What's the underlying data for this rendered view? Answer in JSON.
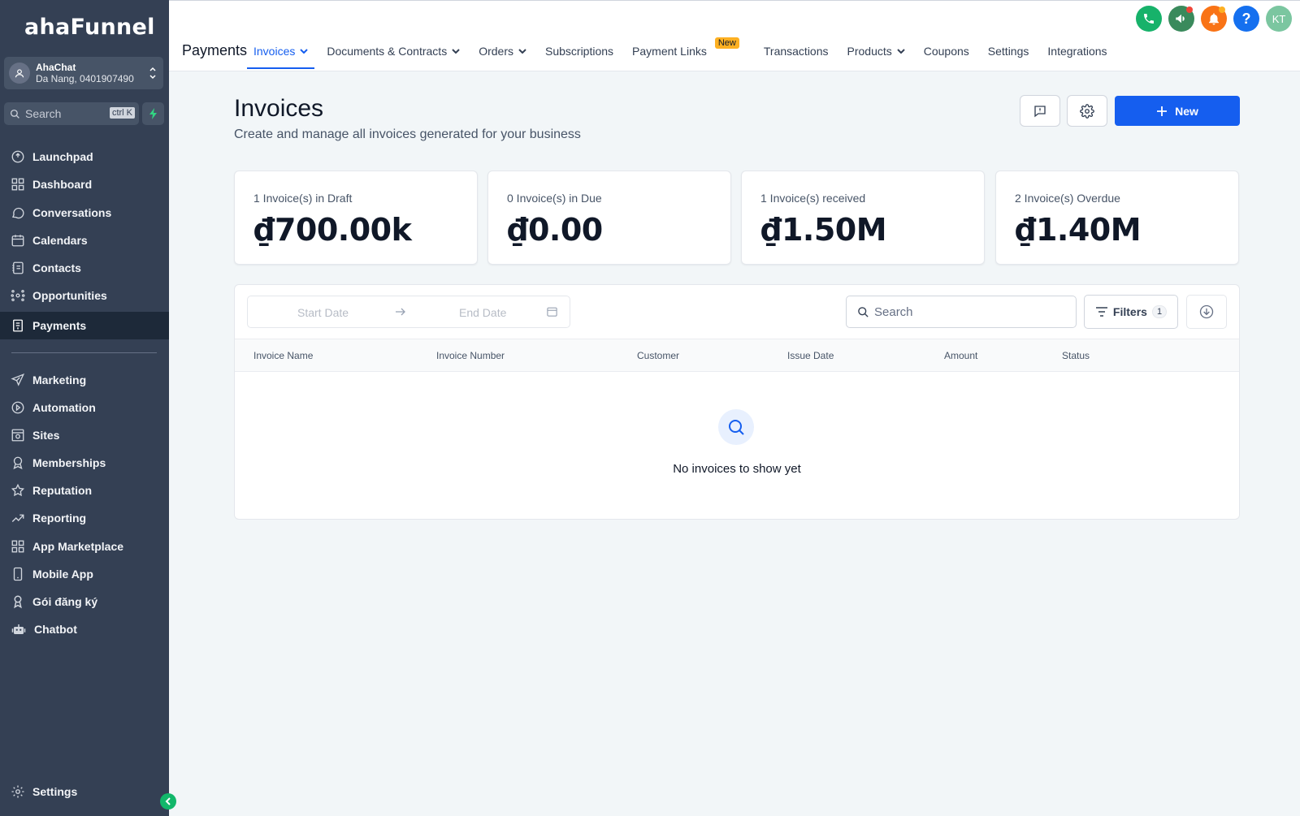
{
  "sidebar": {
    "logo": "ahaFunnel",
    "account": {
      "name": "AhaChat",
      "location": "Da Nang, 0401907490"
    },
    "search": {
      "placeholder": "Search",
      "shortcut": "ctrl K"
    },
    "items": [
      {
        "label": "Launchpad",
        "icon": "launchpad-icon"
      },
      {
        "label": "Dashboard",
        "icon": "dashboard-icon"
      },
      {
        "label": "Conversations",
        "icon": "chat-icon"
      },
      {
        "label": "Calendars",
        "icon": "calendar-icon"
      },
      {
        "label": "Contacts",
        "icon": "contacts-icon"
      },
      {
        "label": "Opportunities",
        "icon": "opportunities-icon"
      },
      {
        "label": "Payments",
        "icon": "payments-icon",
        "active": true
      },
      {
        "label": "Marketing",
        "icon": "send-icon"
      },
      {
        "label": "Automation",
        "icon": "automation-icon"
      },
      {
        "label": "Sites",
        "icon": "sites-icon"
      },
      {
        "label": "Memberships",
        "icon": "award-icon"
      },
      {
        "label": "Reputation",
        "icon": "star-icon"
      },
      {
        "label": "Reporting",
        "icon": "trend-icon"
      },
      {
        "label": "App Marketplace",
        "icon": "grid-icon"
      },
      {
        "label": "Mobile App",
        "icon": "mobile-icon"
      },
      {
        "label": "Gói đăng ký",
        "icon": "badge-icon"
      },
      {
        "label": "Chatbot",
        "icon": "robot-icon"
      }
    ],
    "settings": "Settings"
  },
  "topbar": {
    "title": "Payments",
    "tabs": [
      {
        "label": "Invoices",
        "dropdown": true,
        "active": true
      },
      {
        "label": "Documents & Contracts",
        "dropdown": true
      },
      {
        "label": "Orders",
        "dropdown": true
      },
      {
        "label": "Subscriptions"
      },
      {
        "label": "Payment Links",
        "badge": "New"
      },
      {
        "label": "Transactions"
      },
      {
        "label": "Products",
        "dropdown": true
      },
      {
        "label": "Coupons"
      },
      {
        "label": "Settings"
      },
      {
        "label": "Integrations"
      }
    ],
    "avatar_initials": "KT"
  },
  "main": {
    "title": "Invoices",
    "subtitle": "Create and manage all invoices generated for your business",
    "new_button": "New",
    "cards": [
      {
        "label": "1 Invoice(s) in Draft",
        "value": "₫700.00k"
      },
      {
        "label": "0 Invoice(s) in Due",
        "value": "₫0.00"
      },
      {
        "label": "1 Invoice(s) received",
        "value": "₫1.50M"
      },
      {
        "label": "2 Invoice(s) Overdue",
        "value": "₫1.40M"
      }
    ],
    "date_range": {
      "start": "Start Date",
      "end": "End Date"
    },
    "search_placeholder": "Search",
    "filters": {
      "label": "Filters",
      "count": "1"
    },
    "columns": [
      "Invoice Name",
      "Invoice Number",
      "Customer",
      "Issue Date",
      "Amount",
      "Status"
    ],
    "empty_message": "No invoices to show yet"
  },
  "colors": {
    "sidebar_bg": "#344054",
    "accent": "#155eef",
    "new_badge": "#fdb022"
  }
}
